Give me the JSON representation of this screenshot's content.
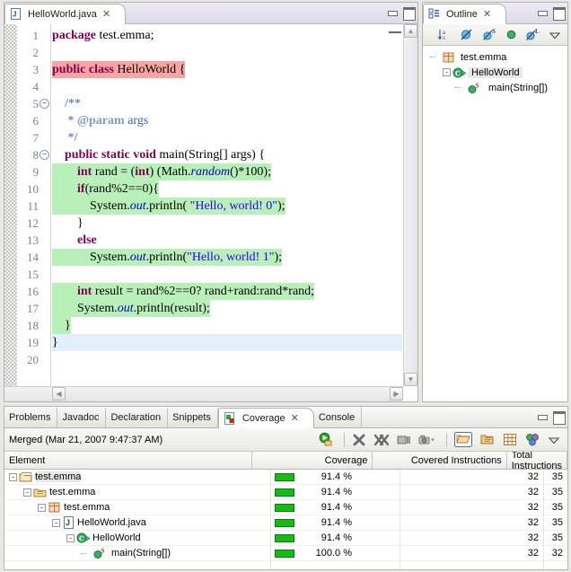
{
  "editor": {
    "tab": {
      "label": "HelloWorld.java",
      "icon": "java-file-icon",
      "close": "✕"
    },
    "window_controls": {
      "minimize": "minimize-icon",
      "maximize": "maximize-icon"
    },
    "lines": [
      {
        "n": "1",
        "fold": false,
        "mark": "none",
        "tokens": [
          {
            "t": "package ",
            "c": "kw"
          },
          {
            "t": "test.emma;",
            "c": ""
          }
        ]
      },
      {
        "n": "2",
        "fold": false,
        "mark": "none",
        "tokens": []
      },
      {
        "n": "3",
        "fold": false,
        "mark": "uncovered",
        "tokens": [
          {
            "t": "public class ",
            "c": "kw"
          },
          {
            "t": "HelloWorld {",
            "c": ""
          }
        ]
      },
      {
        "n": "4",
        "fold": false,
        "mark": "none",
        "tokens": []
      },
      {
        "n": "5",
        "fold": true,
        "mark": "none",
        "tokens": [
          {
            "t": "    /**",
            "c": "jdoc"
          }
        ]
      },
      {
        "n": "6",
        "fold": false,
        "mark": "none",
        "tokens": [
          {
            "t": "     * ",
            "c": "jdoc"
          },
          {
            "t": "@param",
            "c": "jtag"
          },
          {
            "t": " args",
            "c": "jdoc"
          }
        ]
      },
      {
        "n": "7",
        "fold": false,
        "mark": "none",
        "tokens": [
          {
            "t": "     */",
            "c": "jdoc"
          }
        ]
      },
      {
        "n": "8",
        "fold": true,
        "mark": "none",
        "tokens": [
          {
            "t": "    public static void ",
            "c": "kw"
          },
          {
            "t": "main(String[] args) {",
            "c": ""
          }
        ]
      },
      {
        "n": "9",
        "fold": false,
        "mark": "covered",
        "tokens": [
          {
            "t": "        ",
            "c": ""
          },
          {
            "t": "int",
            "c": "kw"
          },
          {
            "t": " rand = (",
            "c": ""
          },
          {
            "t": "int",
            "c": "kw"
          },
          {
            "t": ") (Math.",
            "c": ""
          },
          {
            "t": "random",
            "c": "fld"
          },
          {
            "t": "()*100);",
            "c": ""
          }
        ]
      },
      {
        "n": "10",
        "fold": false,
        "mark": "covered",
        "tokens": [
          {
            "t": "        ",
            "c": ""
          },
          {
            "t": "if",
            "c": "kw"
          },
          {
            "t": "(rand%2==0){",
            "c": ""
          }
        ]
      },
      {
        "n": "11",
        "fold": false,
        "mark": "covered",
        "tokens": [
          {
            "t": "            System.",
            "c": ""
          },
          {
            "t": "out",
            "c": "fld"
          },
          {
            "t": ".println( ",
            "c": ""
          },
          {
            "t": "\"Hello, world! 0\"",
            "c": "str"
          },
          {
            "t": ");",
            "c": ""
          }
        ]
      },
      {
        "n": "12",
        "fold": false,
        "mark": "none",
        "tokens": [
          {
            "t": "        }",
            "c": ""
          }
        ]
      },
      {
        "n": "13",
        "fold": false,
        "mark": "none",
        "tokens": [
          {
            "t": "        ",
            "c": ""
          },
          {
            "t": "else",
            "c": "kw"
          }
        ]
      },
      {
        "n": "14",
        "fold": false,
        "mark": "covered",
        "tokens": [
          {
            "t": "            System.",
            "c": ""
          },
          {
            "t": "out",
            "c": "fld"
          },
          {
            "t": ".println(",
            "c": ""
          },
          {
            "t": "\"Hello, world! 1\"",
            "c": "str"
          },
          {
            "t": ");",
            "c": ""
          }
        ]
      },
      {
        "n": "15",
        "fold": false,
        "mark": "none",
        "tokens": []
      },
      {
        "n": "16",
        "fold": false,
        "mark": "covered",
        "tokens": [
          {
            "t": "        ",
            "c": ""
          },
          {
            "t": "int",
            "c": "kw"
          },
          {
            "t": " result = rand%2==0? rand+rand:rand*rand;",
            "c": ""
          }
        ]
      },
      {
        "n": "17",
        "fold": false,
        "mark": "covered",
        "tokens": [
          {
            "t": "        System.",
            "c": ""
          },
          {
            "t": "out",
            "c": "fld"
          },
          {
            "t": ".println(result);",
            "c": ""
          }
        ]
      },
      {
        "n": "18",
        "fold": false,
        "mark": "covered",
        "tokens": [
          {
            "t": "    }",
            "c": ""
          }
        ]
      },
      {
        "n": "19",
        "fold": false,
        "mark": "current",
        "tokens": [
          {
            "t": "}",
            "c": ""
          }
        ]
      },
      {
        "n": "20",
        "fold": false,
        "mark": "none",
        "tokens": []
      }
    ]
  },
  "outline": {
    "tab": {
      "label": "Outline",
      "icon": "outline-icon",
      "close": "✕"
    },
    "toolbar": [
      {
        "name": "sort-icon",
        "glyph": "↓ᵃz"
      },
      {
        "name": "hide-fields-icon",
        "glyph": "⊘"
      },
      {
        "name": "hide-static-icon",
        "glyph": "S"
      },
      {
        "name": "hide-nonpublic-icon",
        "glyph": "●"
      },
      {
        "name": "hide-local-icon",
        "glyph": "L"
      },
      {
        "name": "view-menu-icon",
        "glyph": "▽"
      }
    ],
    "tree": [
      {
        "label": "test.emma",
        "icon": "package-icon",
        "indent": 0,
        "expander": "none",
        "selected": false
      },
      {
        "label": "HelloWorld",
        "icon": "class-icon",
        "indent": 1,
        "expander": "-",
        "selected": true
      },
      {
        "label": "main(String[])",
        "icon": "method-static-icon",
        "indent": 2,
        "expander": "none",
        "selected": false
      }
    ]
  },
  "coverage": {
    "tabs": [
      {
        "label": "Problems",
        "active": false,
        "icon": ""
      },
      {
        "label": "Javadoc",
        "active": false,
        "icon": ""
      },
      {
        "label": "Declaration",
        "active": false,
        "icon": ""
      },
      {
        "label": "Snippets",
        "active": false,
        "icon": ""
      },
      {
        "label": "Coverage",
        "active": true,
        "icon": "coverage-icon",
        "close": "✕"
      },
      {
        "label": "Console",
        "active": false,
        "icon": ""
      }
    ],
    "merged_label": "Merged (Mar 21, 2007 9:47:37 AM)",
    "toolbar": [
      {
        "name": "refresh-coverage-icon",
        "glyph": "◐"
      },
      {
        "name": "remove-session-icon",
        "glyph": "✖"
      },
      {
        "name": "remove-all-sessions-icon",
        "glyph": "✖"
      },
      {
        "name": "merge-sessions-icon",
        "glyph": "▤"
      },
      {
        "name": "snapshot-icon",
        "glyph": "▣"
      },
      {
        "name": "import-session-icon",
        "glyph": "📂"
      },
      {
        "name": "export-session-icon",
        "glyph": "📁"
      },
      {
        "name": "select-columns-icon",
        "glyph": "▦"
      },
      {
        "name": "coverage-preferences-icon",
        "glyph": "●●"
      },
      {
        "name": "view-menu-icon",
        "glyph": "▽"
      }
    ],
    "columns": [
      "Element",
      "Coverage",
      "Covered Instructions",
      "Total Instructions"
    ],
    "rows": [
      {
        "label": "test.emma",
        "icon": "project-icon",
        "indent": 0,
        "expander": "-",
        "selected": true,
        "coverage": "91.4 %",
        "bar_pct": 91.4,
        "covered": "32",
        "total": "35"
      },
      {
        "label": "test.emma",
        "icon": "source-folder-icon",
        "indent": 1,
        "expander": "-",
        "selected": false,
        "coverage": "91.4 %",
        "bar_pct": 91.4,
        "covered": "32",
        "total": "35"
      },
      {
        "label": "test.emma",
        "icon": "package-icon",
        "indent": 2,
        "expander": "-",
        "selected": false,
        "coverage": "91.4 %",
        "bar_pct": 91.4,
        "covered": "32",
        "total": "35"
      },
      {
        "label": "HelloWorld.java",
        "icon": "java-file-icon",
        "indent": 3,
        "expander": "-",
        "selected": false,
        "coverage": "91.4 %",
        "bar_pct": 91.4,
        "covered": "32",
        "total": "35"
      },
      {
        "label": "HelloWorld",
        "icon": "class-icon",
        "indent": 4,
        "expander": "-",
        "selected": false,
        "coverage": "91.4 %",
        "bar_pct": 91.4,
        "covered": "32",
        "total": "35"
      },
      {
        "label": "main(String[])",
        "icon": "method-static-icon",
        "indent": 5,
        "expander": "none",
        "selected": false,
        "coverage": "100.0 %",
        "bar_pct": 100.0,
        "covered": "32",
        "total": "32"
      }
    ]
  },
  "colors": {
    "covered": "#b9f0b9",
    "uncovered": "#f9a3a3",
    "current_line": "#e3effb",
    "coverage_bar": "#16bb16",
    "keyword": "#7f0055",
    "string": "#2a00ff",
    "javadoc": "#3f5fbf"
  }
}
